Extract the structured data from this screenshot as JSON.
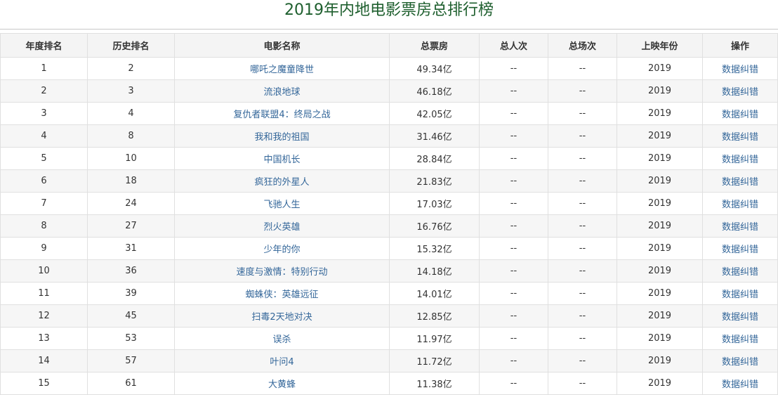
{
  "title": "2019年内地电影票房总排行榜",
  "columns": [
    "年度排名",
    "历史排名",
    "电影名称",
    "总票房",
    "总人次",
    "总场次",
    "上映年份",
    "操作"
  ],
  "rows": [
    {
      "year_rank": "1",
      "hist_rank": "2",
      "name": "哪吒之魔童降世",
      "box": "49.34亿",
      "people": "--",
      "shows": "--",
      "year": "2019",
      "action": "数据纠错"
    },
    {
      "year_rank": "2",
      "hist_rank": "3",
      "name": "流浪地球",
      "box": "46.18亿",
      "people": "--",
      "shows": "--",
      "year": "2019",
      "action": "数据纠错"
    },
    {
      "year_rank": "3",
      "hist_rank": "4",
      "name": "复仇者联盟4：终局之战",
      "box": "42.05亿",
      "people": "--",
      "shows": "--",
      "year": "2019",
      "action": "数据纠错"
    },
    {
      "year_rank": "4",
      "hist_rank": "8",
      "name": "我和我的祖国",
      "box": "31.46亿",
      "people": "--",
      "shows": "--",
      "year": "2019",
      "action": "数据纠错"
    },
    {
      "year_rank": "5",
      "hist_rank": "10",
      "name": "中国机长",
      "box": "28.84亿",
      "people": "--",
      "shows": "--",
      "year": "2019",
      "action": "数据纠错"
    },
    {
      "year_rank": "6",
      "hist_rank": "18",
      "name": "疯狂的外星人",
      "box": "21.83亿",
      "people": "--",
      "shows": "--",
      "year": "2019",
      "action": "数据纠错"
    },
    {
      "year_rank": "7",
      "hist_rank": "24",
      "name": "飞驰人生",
      "box": "17.03亿",
      "people": "--",
      "shows": "--",
      "year": "2019",
      "action": "数据纠错"
    },
    {
      "year_rank": "8",
      "hist_rank": "27",
      "name": "烈火英雄",
      "box": "16.76亿",
      "people": "--",
      "shows": "--",
      "year": "2019",
      "action": "数据纠错"
    },
    {
      "year_rank": "9",
      "hist_rank": "31",
      "name": "少年的你",
      "box": "15.32亿",
      "people": "--",
      "shows": "--",
      "year": "2019",
      "action": "数据纠错"
    },
    {
      "year_rank": "10",
      "hist_rank": "36",
      "name": "速度与激情：特别行动",
      "box": "14.18亿",
      "people": "--",
      "shows": "--",
      "year": "2019",
      "action": "数据纠错"
    },
    {
      "year_rank": "11",
      "hist_rank": "39",
      "name": "蜘蛛侠：英雄远征",
      "box": "14.01亿",
      "people": "--",
      "shows": "--",
      "year": "2019",
      "action": "数据纠错"
    },
    {
      "year_rank": "12",
      "hist_rank": "45",
      "name": "扫毒2天地对决",
      "box": "12.85亿",
      "people": "--",
      "shows": "--",
      "year": "2019",
      "action": "数据纠错"
    },
    {
      "year_rank": "13",
      "hist_rank": "53",
      "name": "误杀",
      "box": "11.97亿",
      "people": "--",
      "shows": "--",
      "year": "2019",
      "action": "数据纠错"
    },
    {
      "year_rank": "14",
      "hist_rank": "57",
      "name": "叶问4",
      "box": "11.72亿",
      "people": "--",
      "shows": "--",
      "year": "2019",
      "action": "数据纠错"
    },
    {
      "year_rank": "15",
      "hist_rank": "61",
      "name": "大黄蜂",
      "box": "11.38亿",
      "people": "--",
      "shows": "--",
      "year": "2019",
      "action": "数据纠错"
    }
  ],
  "colors": {
    "title": "#1e5f2e",
    "link": "#336699",
    "header_bg": "#f4f4f4",
    "stripe_bg": "#f6f6f6"
  }
}
